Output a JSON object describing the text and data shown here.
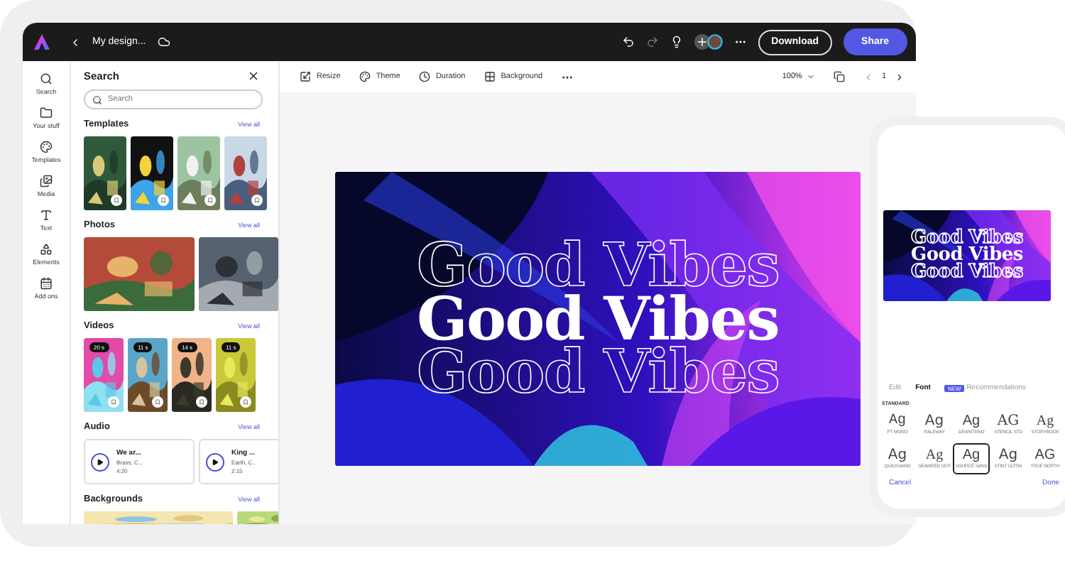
{
  "topbar": {
    "title": "My design...",
    "download": "Download",
    "share": "Share"
  },
  "rail": [
    {
      "label": "Search"
    },
    {
      "label": "Your stuff"
    },
    {
      "label": "Templates"
    },
    {
      "label": "Media"
    },
    {
      "label": "Text"
    },
    {
      "label": "Elements"
    },
    {
      "label": "Add ons"
    }
  ],
  "panel": {
    "title": "Search",
    "search": {
      "placeholder": "Search"
    },
    "sections": [
      {
        "title": "Templates",
        "link": "View all",
        "kind": "templates"
      },
      {
        "title": "Photos",
        "link": "View all",
        "kind": "photos"
      },
      {
        "title": "Videos",
        "link": "View all",
        "kind": "videos",
        "items": [
          {
            "duration": "20 s"
          },
          {
            "duration": "11 s"
          },
          {
            "duration": "14 s"
          },
          {
            "duration": "11 s"
          }
        ]
      },
      {
        "title": "Audio",
        "link": "View all",
        "kind": "audio",
        "items": [
          {
            "title": "We ar...",
            "artist": "Brass, C...",
            "time": "4:20"
          },
          {
            "title": "King ...",
            "artist": "Earth, C...",
            "time": "2:15"
          }
        ]
      },
      {
        "title": "Backgrounds",
        "link": "View all",
        "kind": "backgrounds"
      }
    ]
  },
  "toolbar": {
    "tools": [
      {
        "label": "Resize"
      },
      {
        "label": "Theme"
      },
      {
        "label": "Duration"
      },
      {
        "label": "Background"
      }
    ],
    "zoom": "100%",
    "page": "1"
  },
  "canvas": {
    "lines": [
      {
        "text": "Good Vibes",
        "kind": "outline"
      },
      {
        "text": "Good Vibes",
        "kind": "solid"
      },
      {
        "text": "Good Vibes",
        "kind": "outline"
      }
    ]
  },
  "phone": {
    "preview_lines": [
      {
        "text": "Good Vibes",
        "kind": "outline"
      },
      {
        "text": "Good Vibes",
        "kind": "solid"
      },
      {
        "text": "Good Vibes",
        "kind": "outline"
      }
    ],
    "tabs": [
      {
        "label": "Edit",
        "selected": false
      },
      {
        "label": "Font",
        "selected": true
      },
      {
        "label": "Recommendations",
        "selected": false,
        "badge": "NEW"
      }
    ],
    "section": "STANDARD",
    "fonts": [
      {
        "sample": "Ag",
        "name": "PT MONO",
        "selected": false
      },
      {
        "sample": "Ag",
        "name": "RALEWAY",
        "selected": false
      },
      {
        "sample": "Ag",
        "name": "GRANITENO",
        "selected": false
      },
      {
        "sample": "AG",
        "name": "STENCIL STD",
        "selected": false
      },
      {
        "sample": "Ag",
        "name": "STORYBOOK",
        "selected": false
      },
      {
        "sample": "Ag",
        "name": "QUICKSAND",
        "selected": false
      },
      {
        "sample": "Ag",
        "name": "SEAWEED SCR",
        "selected": false
      },
      {
        "sample": "Ag",
        "name": "SOURCE SANS",
        "selected": true
      },
      {
        "sample": "Ag",
        "name": "STINT ULTRA",
        "selected": false
      },
      {
        "sample": "AG",
        "name": "TRUE NORTH",
        "selected": false
      }
    ],
    "cancel": "Cancel",
    "done": "Done"
  }
}
